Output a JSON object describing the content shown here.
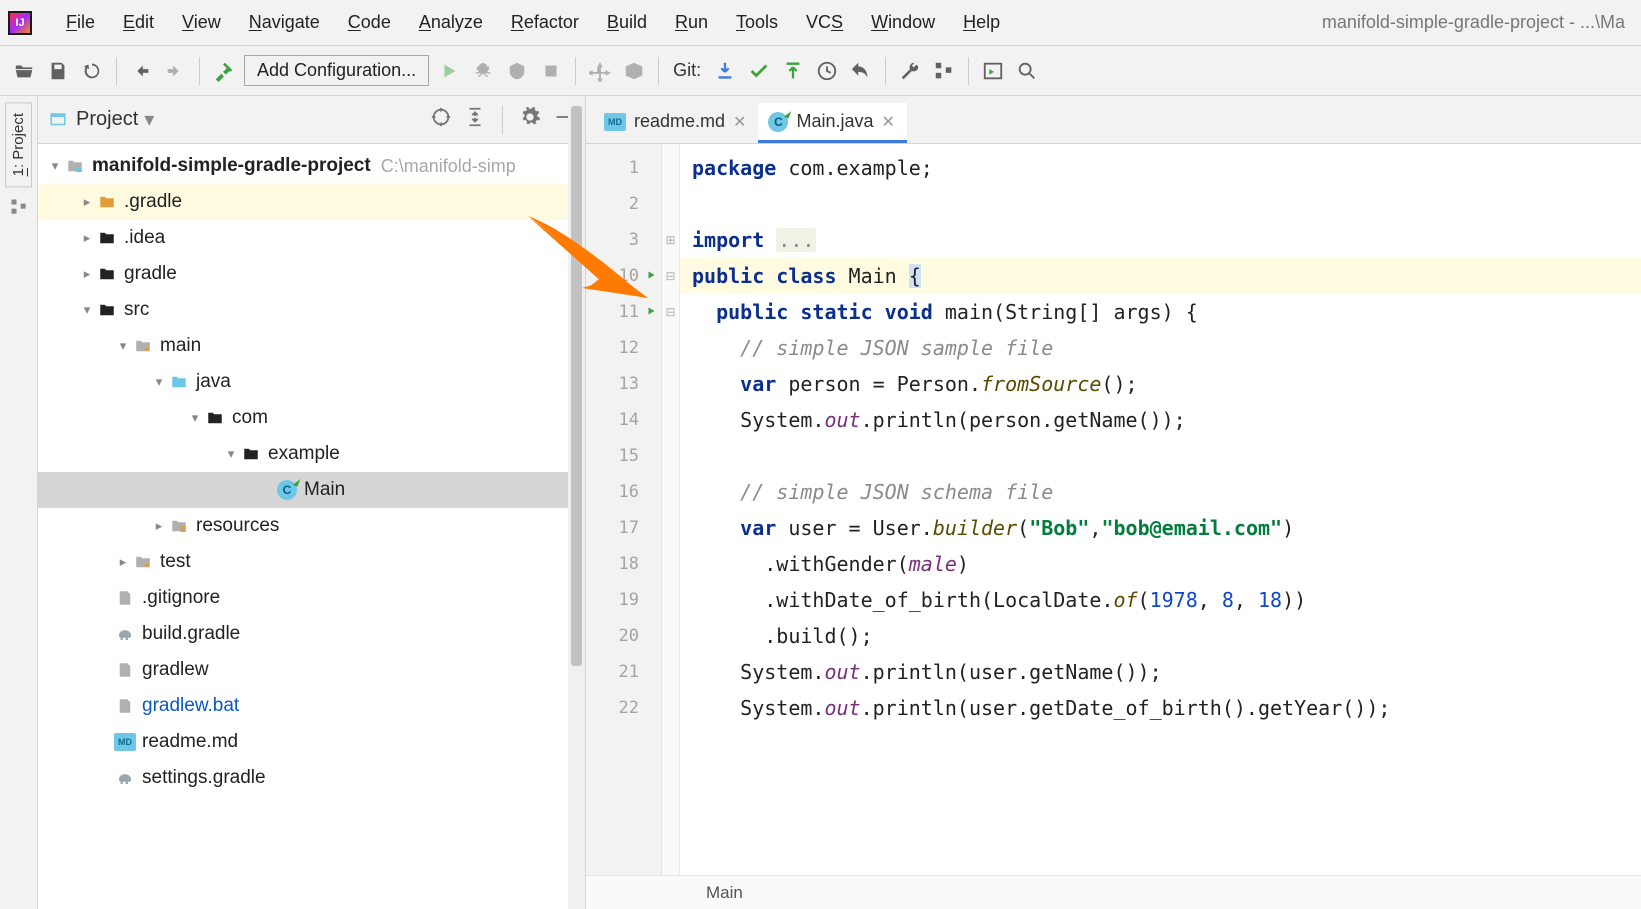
{
  "menu": {
    "items": [
      "File",
      "Edit",
      "View",
      "Navigate",
      "Code",
      "Analyze",
      "Refactor",
      "Build",
      "Run",
      "Tools",
      "VCS",
      "Window",
      "Help"
    ],
    "hot": [
      0,
      0,
      0,
      0,
      0,
      0,
      0,
      0,
      0,
      0,
      2,
      0,
      0
    ]
  },
  "window_title": "manifold-simple-gradle-project - ...\\Ma",
  "toolbar": {
    "config": "Add Configuration...",
    "git": "Git:"
  },
  "project_panel": {
    "title": "Project"
  },
  "tree": {
    "root": {
      "name": "manifold-simple-gradle-project",
      "path": "C:\\manifold-simp"
    },
    "items": [
      {
        "name": ".gradle"
      },
      {
        "name": ".idea"
      },
      {
        "name": "gradle"
      },
      {
        "name": "src"
      },
      {
        "name": "main"
      },
      {
        "name": "java"
      },
      {
        "name": "com"
      },
      {
        "name": "example"
      },
      {
        "name": "Main"
      },
      {
        "name": "resources"
      },
      {
        "name": "test"
      },
      {
        "name": ".gitignore"
      },
      {
        "name": "build.gradle"
      },
      {
        "name": "gradlew"
      },
      {
        "name": "gradlew.bat"
      },
      {
        "name": "readme.md"
      },
      {
        "name": "settings.gradle"
      }
    ]
  },
  "tabs": [
    {
      "label": "readme.md"
    },
    {
      "label": "Main.java"
    }
  ],
  "gutter_lines": [
    "1",
    "2",
    "3",
    "10",
    "11",
    "12",
    "13",
    "14",
    "15",
    "16",
    "17",
    "18",
    "19",
    "20",
    "21",
    "22"
  ],
  "code": {
    "l1": {
      "kw": "package",
      "rest": " com.example;"
    },
    "l3": {
      "kw": "import",
      "ell": "..."
    },
    "l10": {
      "a": "public class ",
      "b": "Main ",
      "c": "{"
    },
    "l11": {
      "a": "public static void ",
      "b": "main(String[] args) {"
    },
    "l12": "// simple JSON sample file",
    "l13": {
      "a": "var ",
      "b": "person = Person.",
      "c": "fromSource",
      "d": "();"
    },
    "l14": {
      "a": "System.",
      "b": "out",
      "c": ".println(person.getName());"
    },
    "l16": "// simple JSON schema file",
    "l17": {
      "a": "var ",
      "b": "user = User.",
      "c": "builder",
      "d": "(",
      "s1": "\"Bob\"",
      "e": ",",
      "s2": "\"bob@email.com\"",
      "f": ")"
    },
    "l18": {
      "a": ".withGender(",
      "b": "male",
      "c": ")"
    },
    "l19": {
      "a": ".withDate_of_birth(LocalDate.",
      "b": "of",
      "c": "(",
      "n1": "1978",
      "d": ", ",
      "n2": "8",
      "e": ", ",
      "n3": "18",
      "f": "))"
    },
    "l20": ".build();",
    "l21": {
      "a": "System.",
      "b": "out",
      "c": ".println(user.getName());"
    },
    "l22": {
      "a": "System.",
      "b": "out",
      "c": ".println(user.getDate_of_birth().getYear());"
    }
  },
  "breadcrumb": "Main"
}
